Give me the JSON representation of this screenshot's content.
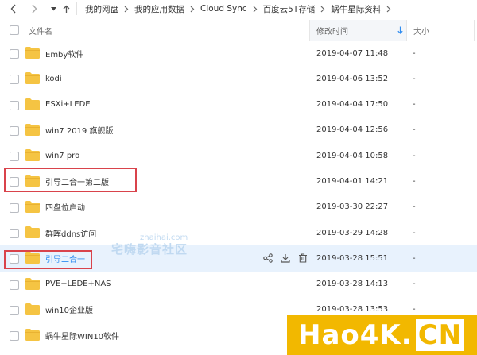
{
  "breadcrumbs": [
    "我的网盘",
    "我的应用数据",
    "Cloud Sync",
    "百度云5T存储",
    "蜗牛星际资料"
  ],
  "columns": {
    "name": "文件名",
    "date": "修改时间",
    "size": "大小"
  },
  "rows": [
    {
      "name": "Emby软件",
      "date": "2019-04-07 11:48",
      "size": "-"
    },
    {
      "name": "kodi",
      "date": "2019-04-06 13:52",
      "size": "-"
    },
    {
      "name": "ESXi+LEDE",
      "date": "2019-04-04 17:50",
      "size": "-"
    },
    {
      "name": "win7 2019 旗舰版",
      "date": "2019-04-04 12:56",
      "size": "-"
    },
    {
      "name": "win7 pro",
      "date": "2019-04-04 10:58",
      "size": "-"
    },
    {
      "name": "引导二合一第二版",
      "date": "2019-04-01 14:21",
      "size": "-"
    },
    {
      "name": "四盘位启动",
      "date": "2019-03-30 22:27",
      "size": "-"
    },
    {
      "name": "群晖ddns访问",
      "date": "2019-03-29 14:28",
      "size": "-"
    },
    {
      "name": "引导二合一",
      "date": "2019-03-28 15:51",
      "size": "-"
    },
    {
      "name": "PVE+LEDE+NAS",
      "date": "2019-03-28 14:13",
      "size": "-"
    },
    {
      "name": "win10企业版",
      "date": "2019-03-28 13:53",
      "size": "-"
    },
    {
      "name": "蜗牛星际WIN10软件",
      "date": "",
      "size": ""
    }
  ],
  "watermark": {
    "small": "zhaihai.com",
    "big": "宅嗨影音社区"
  },
  "logo": {
    "text": "Hao4K.",
    "suffix": "CN"
  },
  "colors": {
    "accent": "#2f8cf0",
    "folder": "#f5c443",
    "highlight_row": "#e8f2fd",
    "annotation_box": "#d9434b",
    "logo_bg": "#f2b800"
  },
  "icons": {
    "back": "chevron-left-icon",
    "forward": "chevron-right-icon",
    "history": "dropdown-icon",
    "up": "arrow-up-icon",
    "sort": "sort-down-arrow-icon",
    "share": "share-icon",
    "download": "download-icon",
    "delete": "trash-icon",
    "folder": "folder-icon"
  }
}
